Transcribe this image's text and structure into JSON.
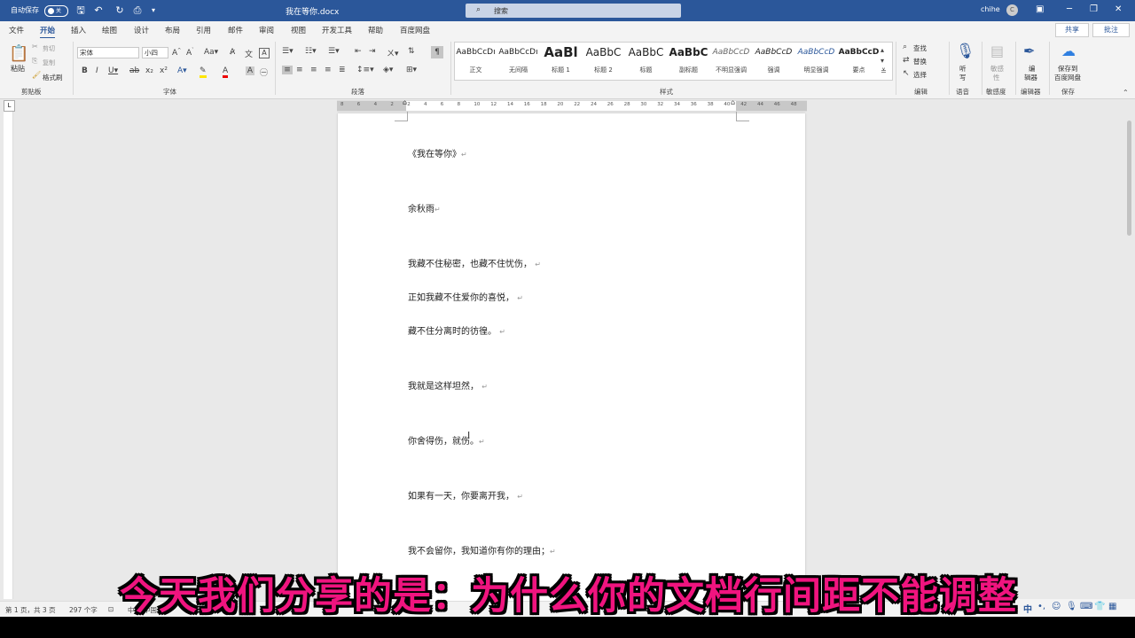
{
  "titlebar": {
    "autosave_label": "自动保存",
    "autosave_state": "关",
    "document_title": "我在等你.docx",
    "search_placeholder": "搜索",
    "user_name": "chihe",
    "avatar_initial": "C"
  },
  "menu": {
    "tabs": [
      "文件",
      "开始",
      "插入",
      "绘图",
      "设计",
      "布局",
      "引用",
      "邮件",
      "审阅",
      "视图",
      "开发工具",
      "帮助",
      "百度网盘"
    ],
    "active_tab": "开始",
    "share_label": "共享",
    "comment_label": "批注"
  },
  "ribbon": {
    "clipboard": {
      "paste": "粘贴",
      "cut": "剪切",
      "copy": "复制",
      "format_painter": "格式刷",
      "group": "剪贴板"
    },
    "font": {
      "name": "宋体",
      "size": "小四",
      "group": "字体"
    },
    "paragraph": {
      "group": "段落"
    },
    "styles": {
      "group": "样式",
      "items": [
        {
          "preview": "AaBbCcDı",
          "name": "正文"
        },
        {
          "preview": "AaBbCcDı",
          "name": "无间隔"
        },
        {
          "preview": "AaBl",
          "name": "标题 1"
        },
        {
          "preview": "AaBbC",
          "name": "标题 2"
        },
        {
          "preview": "AaBbC",
          "name": "标题"
        },
        {
          "preview": "AaBbC",
          "name": "副标题"
        },
        {
          "preview": "AaBbCcD",
          "name": "不明显强调"
        },
        {
          "preview": "AaBbCcD",
          "name": "强调"
        },
        {
          "preview": "AaBbCcD",
          "name": "明显强调"
        },
        {
          "preview": "AaBbCcD",
          "name": "要点"
        }
      ]
    },
    "editing": {
      "find": "查找",
      "replace": "替换",
      "select": "选择",
      "group": "编辑"
    },
    "voice": {
      "dictate_top": "听",
      "dictate_bottom": "写",
      "group": "语音"
    },
    "sensitivity": {
      "label_top": "敏感",
      "label_bottom": "性",
      "group": "敏感度"
    },
    "editor": {
      "label_top": "编",
      "label_bottom": "辑器",
      "group": "编辑器"
    },
    "save": {
      "label_top": "保存到",
      "label_bottom": "百度网盘",
      "group": "保存"
    }
  },
  "ruler_numbers": [
    "8",
    "6",
    "4",
    "2",
    "2",
    "4",
    "6",
    "8",
    "10",
    "12",
    "14",
    "16",
    "18",
    "20",
    "22",
    "24",
    "26",
    "28",
    "30",
    "32",
    "34",
    "36",
    "38",
    "40",
    "42",
    "44",
    "46",
    "48"
  ],
  "document": {
    "lines": [
      "《我在等你》",
      "余秋雨",
      "我藏不住秘密，也藏不住忧伤，",
      "正如我藏不住爱你的喜悦，",
      "藏不住分离时的彷徨。",
      "我就是这样坦然，",
      "你舍得伤，就伤。",
      "如果有一天，你要离开我，",
      "我不会留你，我知道你有你的理由；"
    ],
    "paragraph_mark": "↵"
  },
  "status": {
    "page": "第 1 页，共 3 页",
    "words": "297 个字",
    "lang": "中文(中国)"
  },
  "caption": "今天我们分享的是：为什么你的文档行间距不能调整",
  "tray": {
    "ime": "中"
  }
}
